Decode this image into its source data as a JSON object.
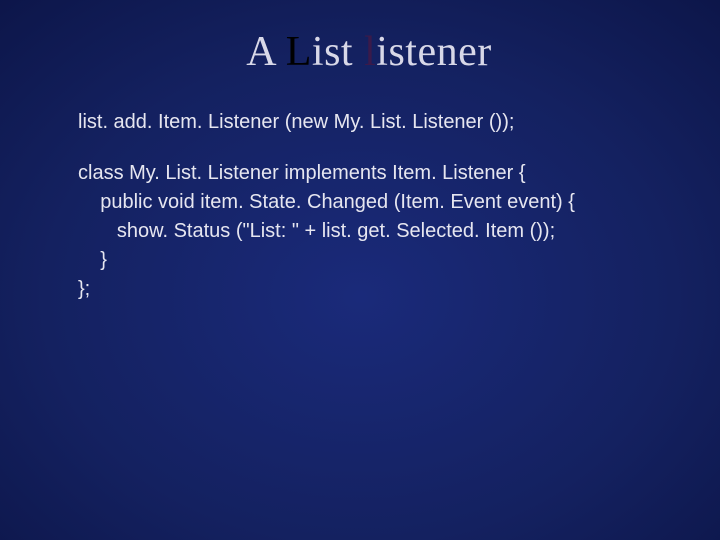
{
  "title": {
    "part1": "A ",
    "part2": "L",
    "part3": "ist ",
    "part4": "l",
    "part5": "istener"
  },
  "code": {
    "line1": "list. add. Item. Listener (new My. List. Listener ());",
    "block2": "class My. List. Listener implements Item. Listener {\n    public void item. State. Changed (Item. Event event) {\n       show. Status (\"List: \" + list. get. Selected. Item ());\n    }\n};"
  }
}
